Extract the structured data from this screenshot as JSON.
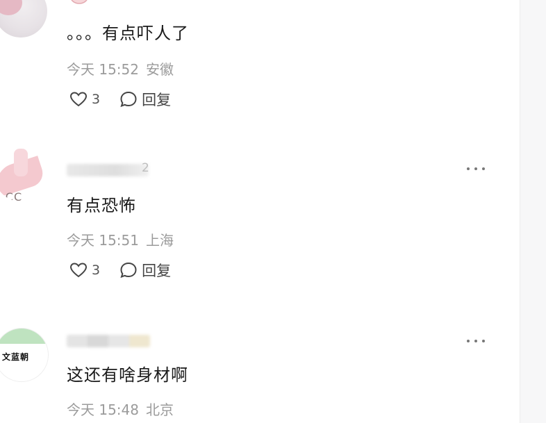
{
  "comments": [
    {
      "text": "。。。有点吓人了",
      "time": "今天 15:52",
      "location": "安徽",
      "likes": "3",
      "reply_label": "回复"
    },
    {
      "username_partial": "2",
      "text": "有点恐怖",
      "time": "今天 15:51",
      "location": "上海",
      "likes": "3",
      "reply_label": "回复"
    },
    {
      "avatar_text": "文蓝朝",
      "text": "这还有啥身材啊",
      "time": "今天 15:48",
      "location": "北京"
    }
  ],
  "icons": {
    "like": "heart-outline-icon",
    "reply": "chat-bubble-icon",
    "more": "ellipsis-icon"
  },
  "colors": {
    "text": "#1a1a1a",
    "meta": "#9b9b9b",
    "icon": "#444444"
  }
}
